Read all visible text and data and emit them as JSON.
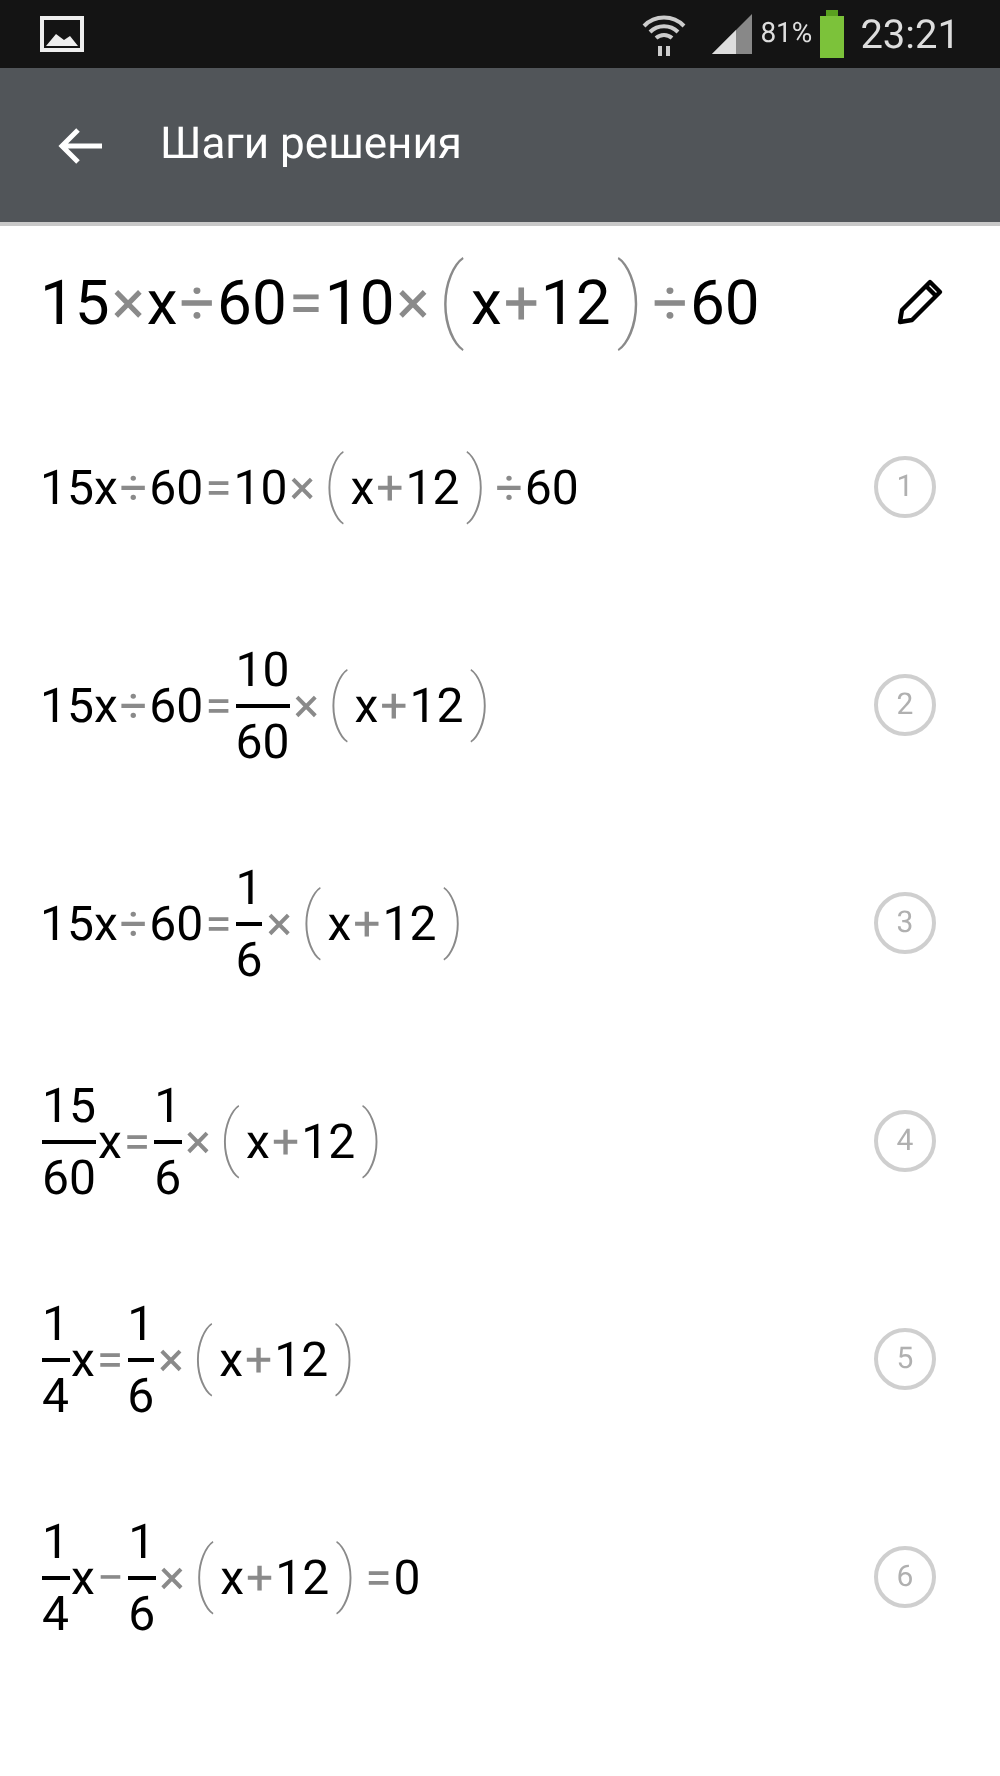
{
  "status_bar": {
    "battery": "81%",
    "time": "23:21"
  },
  "app_bar": {
    "title": "Шаги решения"
  },
  "problem": [
    {
      "kind": "term",
      "text": "15"
    },
    {
      "kind": "op",
      "text": "×"
    },
    {
      "kind": "term",
      "text": "x"
    },
    {
      "kind": "op",
      "text": "÷"
    },
    {
      "kind": "term",
      "text": "60"
    },
    {
      "kind": "op",
      "text": "="
    },
    {
      "kind": "term",
      "text": "10"
    },
    {
      "kind": "op",
      "text": "×"
    },
    {
      "kind": "paren",
      "text": "("
    },
    {
      "kind": "term",
      "text": "x"
    },
    {
      "kind": "op",
      "text": "+"
    },
    {
      "kind": "term",
      "text": "12"
    },
    {
      "kind": "paren",
      "text": ")"
    },
    {
      "kind": "op",
      "text": "÷"
    },
    {
      "kind": "term",
      "text": "60"
    }
  ],
  "steps": [
    {
      "number": "1",
      "tokens": [
        {
          "kind": "term",
          "text": "15x"
        },
        {
          "kind": "op",
          "text": "÷"
        },
        {
          "kind": "term",
          "text": "60"
        },
        {
          "kind": "op",
          "text": "="
        },
        {
          "kind": "term",
          "text": "10"
        },
        {
          "kind": "op",
          "text": "×"
        },
        {
          "kind": "paren",
          "text": "("
        },
        {
          "kind": "term",
          "text": "x"
        },
        {
          "kind": "op",
          "text": "+"
        },
        {
          "kind": "term",
          "text": "12"
        },
        {
          "kind": "paren",
          "text": ")"
        },
        {
          "kind": "op",
          "text": "÷"
        },
        {
          "kind": "term",
          "text": "60"
        }
      ]
    },
    {
      "number": "2",
      "tokens": [
        {
          "kind": "term",
          "text": "15x"
        },
        {
          "kind": "op",
          "text": "÷"
        },
        {
          "kind": "term",
          "text": "60"
        },
        {
          "kind": "op",
          "text": "="
        },
        {
          "kind": "frac",
          "num": "10",
          "den": "60"
        },
        {
          "kind": "op",
          "text": "×"
        },
        {
          "kind": "paren",
          "text": "("
        },
        {
          "kind": "term",
          "text": "x"
        },
        {
          "kind": "op",
          "text": "+"
        },
        {
          "kind": "term",
          "text": "12"
        },
        {
          "kind": "paren",
          "text": ")"
        }
      ]
    },
    {
      "number": "3",
      "tokens": [
        {
          "kind": "term",
          "text": "15x"
        },
        {
          "kind": "op",
          "text": "÷"
        },
        {
          "kind": "term",
          "text": "60"
        },
        {
          "kind": "op",
          "text": "="
        },
        {
          "kind": "frac",
          "num": "1",
          "den": "6"
        },
        {
          "kind": "op",
          "text": "×"
        },
        {
          "kind": "paren",
          "text": "("
        },
        {
          "kind": "term",
          "text": "x"
        },
        {
          "kind": "op",
          "text": "+"
        },
        {
          "kind": "term",
          "text": "12"
        },
        {
          "kind": "paren",
          "text": ")"
        }
      ]
    },
    {
      "number": "4",
      "tokens": [
        {
          "kind": "frac",
          "num": "15",
          "den": "60"
        },
        {
          "kind": "term",
          "text": "x"
        },
        {
          "kind": "op",
          "text": "="
        },
        {
          "kind": "frac",
          "num": "1",
          "den": "6"
        },
        {
          "kind": "op",
          "text": "×"
        },
        {
          "kind": "paren",
          "text": "("
        },
        {
          "kind": "term",
          "text": "x"
        },
        {
          "kind": "op",
          "text": "+"
        },
        {
          "kind": "term",
          "text": "12"
        },
        {
          "kind": "paren",
          "text": ")"
        }
      ]
    },
    {
      "number": "5",
      "tokens": [
        {
          "kind": "frac",
          "num": "1",
          "den": "4"
        },
        {
          "kind": "term",
          "text": "x"
        },
        {
          "kind": "op",
          "text": "="
        },
        {
          "kind": "frac",
          "num": "1",
          "den": "6"
        },
        {
          "kind": "op",
          "text": "×"
        },
        {
          "kind": "paren",
          "text": "("
        },
        {
          "kind": "term",
          "text": "x"
        },
        {
          "kind": "op",
          "text": "+"
        },
        {
          "kind": "term",
          "text": "12"
        },
        {
          "kind": "paren",
          "text": ")"
        }
      ]
    },
    {
      "number": "6",
      "tokens": [
        {
          "kind": "frac",
          "num": "1",
          "den": "4"
        },
        {
          "kind": "term",
          "text": "x"
        },
        {
          "kind": "op",
          "text": "−"
        },
        {
          "kind": "frac",
          "num": "1",
          "den": "6"
        },
        {
          "kind": "op",
          "text": "×"
        },
        {
          "kind": "paren",
          "text": "("
        },
        {
          "kind": "term",
          "text": "x"
        },
        {
          "kind": "op",
          "text": "+"
        },
        {
          "kind": "term",
          "text": "12"
        },
        {
          "kind": "paren",
          "text": ")"
        },
        {
          "kind": "op",
          "text": "="
        },
        {
          "kind": "term",
          "text": "0"
        }
      ]
    }
  ]
}
